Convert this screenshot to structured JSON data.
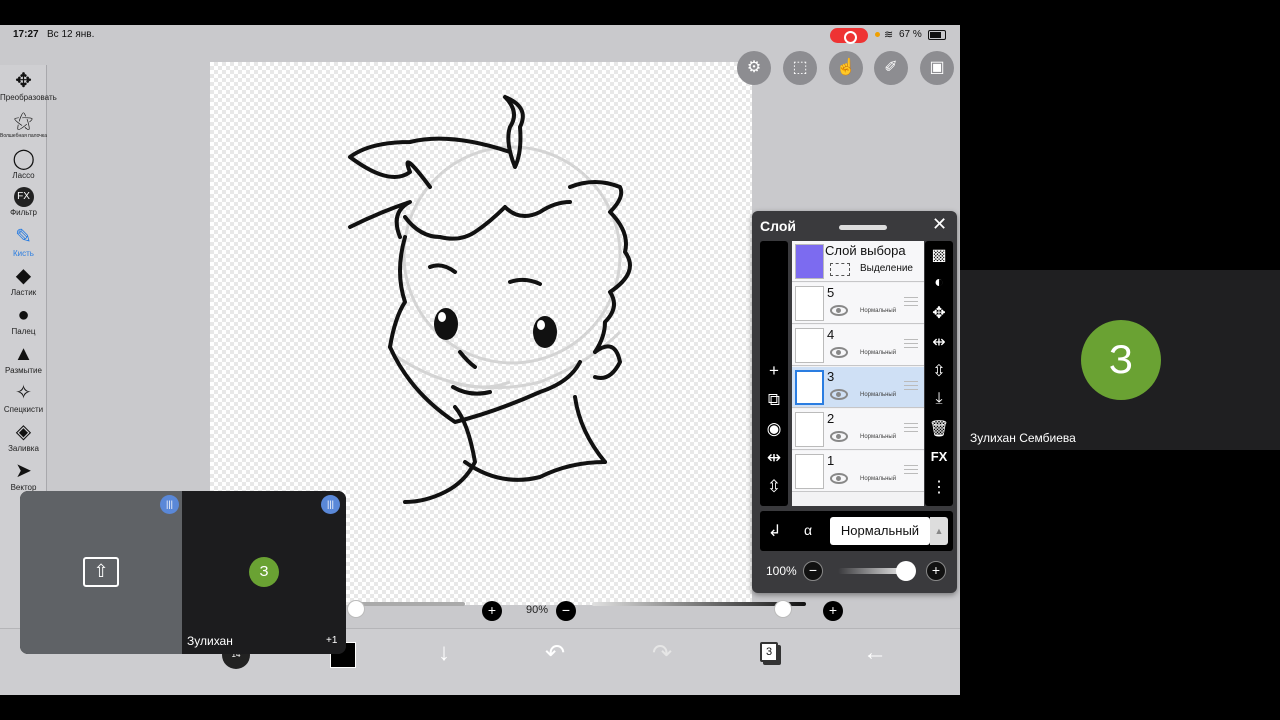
{
  "status": {
    "time": "17:27",
    "date": "Вс 12 янв.",
    "battery": "67 %"
  },
  "tools": [
    {
      "label": "Преобразовать",
      "icon": "move-icon",
      "glyph": "✥"
    },
    {
      "label": "Волшебная палочка",
      "icon": "magic-wand-icon",
      "glyph": "✦"
    },
    {
      "label": "Лассо",
      "icon": "lasso-icon",
      "glyph": "◯"
    },
    {
      "label": "Фильтр",
      "icon": "fx-icon",
      "glyph": "FX"
    },
    {
      "label": "Кисть",
      "icon": "brush-icon",
      "glyph": "✎"
    },
    {
      "label": "Ластик",
      "icon": "eraser-icon",
      "glyph": "◆"
    },
    {
      "label": "Палец",
      "icon": "finger-icon",
      "glyph": "●"
    },
    {
      "label": "Размытие",
      "icon": "blur-icon",
      "glyph": "💧"
    },
    {
      "label": "Спецкисти",
      "icon": "special-brush-icon",
      "glyph": "✧"
    },
    {
      "label": "Заливка",
      "icon": "fill-icon",
      "glyph": "◈"
    },
    {
      "label": "Вектор",
      "icon": "vector-icon",
      "glyph": "➤"
    }
  ],
  "layer_panel": {
    "title": "Слой",
    "selection_layer": {
      "name": "Слой выбора",
      "sub": "Выделение"
    },
    "layers": [
      {
        "num": "5",
        "mode": "Нормальный"
      },
      {
        "num": "4",
        "mode": "Нормальный"
      },
      {
        "num": "3",
        "mode": "Нормальный"
      },
      {
        "num": "2",
        "mode": "Нормальный"
      },
      {
        "num": "1",
        "mode": "Нормальный"
      }
    ],
    "blend_mode": "Нормальный",
    "opacity": "100%",
    "opacity_value": 1.0
  },
  "zoom": "90%",
  "brush_size": "14",
  "layer_count": "3",
  "call": {
    "name": "Зулихан",
    "avatar": "З",
    "extra": "+1"
  },
  "participant": {
    "avatar": "З",
    "name": "Зулихан Сембиева"
  },
  "colors": {
    "accent": "#2a7de1",
    "avatar": "#6aa233",
    "panel": "#3a3a3d",
    "record": "#e33"
  }
}
